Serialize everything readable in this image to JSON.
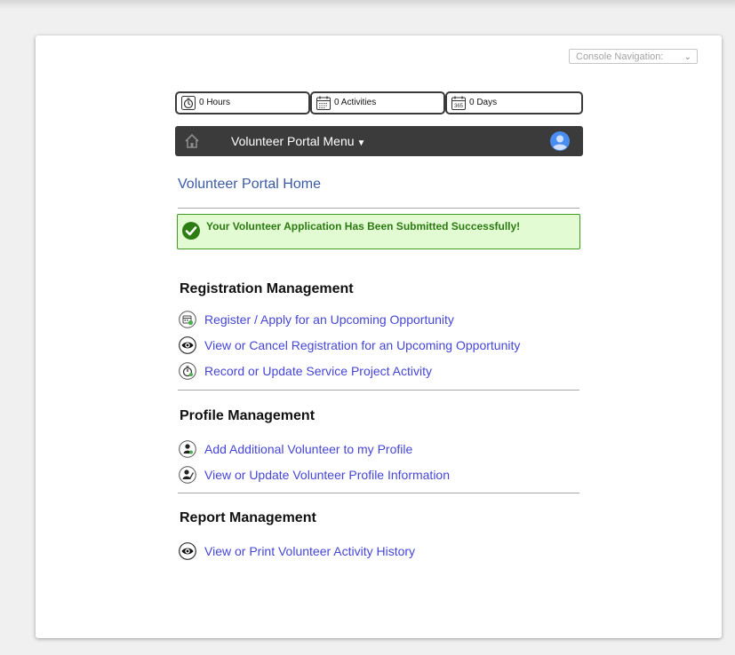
{
  "console_nav": {
    "placeholder": "Console Navigation:"
  },
  "stats": [
    {
      "icon": "stopwatch-icon",
      "label": "0 Hours"
    },
    {
      "icon": "calendar-icon",
      "label": "0 Activities"
    },
    {
      "icon": "calendar-365-icon",
      "label": "0 Days"
    }
  ],
  "menu": {
    "label": "Volunteer Portal Menu"
  },
  "page": {
    "title": "Volunteer Portal Home"
  },
  "alert": {
    "message": "Your Volunteer Application Has Been Submitted Successfully!",
    "color": "#2c7a12"
  },
  "sections": [
    {
      "heading": "Registration Management",
      "items": [
        {
          "icon": "calendar-plus-icon",
          "label": "Register / Apply for an Upcoming Opportunity"
        },
        {
          "icon": "eye-icon",
          "label": "View or Cancel Registration for an Upcoming Opportunity"
        },
        {
          "icon": "stopwatch-icon",
          "label": "Record or Update Service Project Activity"
        }
      ]
    },
    {
      "heading": "Profile Management",
      "items": [
        {
          "icon": "add-person-icon",
          "label": "Add Additional Volunteer to my Profile"
        },
        {
          "icon": "edit-person-icon",
          "label": "View or Update Volunteer Profile Information"
        }
      ]
    },
    {
      "heading": "Report Management",
      "items": [
        {
          "icon": "eye-icon",
          "label": "View or Print Volunteer Activity History"
        }
      ]
    }
  ],
  "colors": {
    "link": "#4545d9",
    "title": "#3b5aa6",
    "menubar": "#3b3b3b",
    "success_bg": "#e2fbd2"
  }
}
